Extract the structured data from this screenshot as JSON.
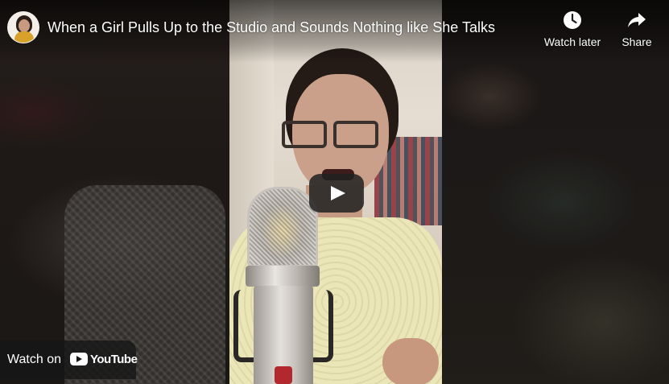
{
  "video": {
    "title": "When a Girl Pulls Up to the Studio and Sounds Nothing like She Talks",
    "channel_avatar_icon": "channel-avatar-icon"
  },
  "actions": {
    "watch_later_label": "Watch later",
    "watch_later_icon": "clock-icon",
    "share_label": "Share",
    "share_icon": "share-arrow-icon"
  },
  "player": {
    "play_icon": "play-icon"
  },
  "watch_on": {
    "label": "Watch on",
    "brand": "YouTube",
    "brand_icon": "youtube-logo-icon"
  },
  "colors": {
    "overlay": "#000000",
    "text": "#ffffff",
    "button_bg": "#212121"
  }
}
